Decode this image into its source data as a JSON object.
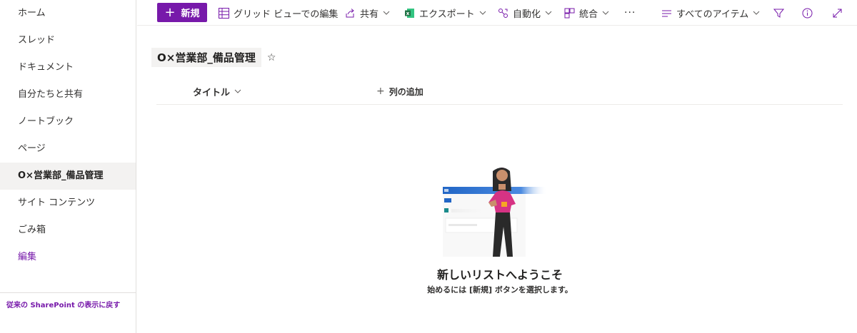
{
  "sidebar": {
    "items": [
      {
        "label": "ホーム"
      },
      {
        "label": "スレッド"
      },
      {
        "label": "ドキュメント"
      },
      {
        "label": "自分たちと共有"
      },
      {
        "label": "ノートブック"
      },
      {
        "label": "ページ"
      },
      {
        "label": "O×営業部_備品管理"
      },
      {
        "label": "サイト コンテンツ"
      },
      {
        "label": "ごみ箱"
      },
      {
        "label": "編集"
      }
    ],
    "footer_link": "従来の SharePoint の表示に戻す"
  },
  "commandbar": {
    "new_label": "新規",
    "grid_view_label": "グリッド ビューでの編集",
    "share_label": "共有",
    "export_label": "エクスポート",
    "automate_label": "自動化",
    "integrate_label": "統合",
    "more_label": "···",
    "view_label": "すべてのアイテム"
  },
  "list": {
    "title": "O×営業部_備品管理",
    "column_title": "タイトル",
    "add_column": "列の追加"
  },
  "empty_state": {
    "heading": "新しいリストへようこそ",
    "subtext": "始めるには [新規] ボタンを選択します。"
  },
  "colors": {
    "accent": "#7719aa",
    "nav_active_bg": "#f3f2f1",
    "excel_green": "#217346"
  }
}
